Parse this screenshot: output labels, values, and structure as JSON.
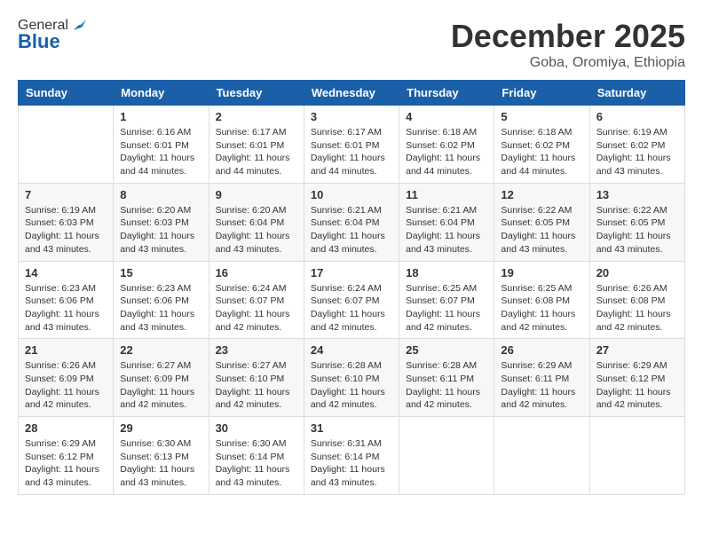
{
  "logo": {
    "general": "General",
    "blue": "Blue"
  },
  "header": {
    "month": "December 2025",
    "location": "Goba, Oromiya, Ethiopia"
  },
  "weekdays": [
    "Sunday",
    "Monday",
    "Tuesday",
    "Wednesday",
    "Thursday",
    "Friday",
    "Saturday"
  ],
  "weeks": [
    [
      {
        "day": "",
        "info": ""
      },
      {
        "day": "1",
        "info": "Sunrise: 6:16 AM\nSunset: 6:01 PM\nDaylight: 11 hours\nand 44 minutes."
      },
      {
        "day": "2",
        "info": "Sunrise: 6:17 AM\nSunset: 6:01 PM\nDaylight: 11 hours\nand 44 minutes."
      },
      {
        "day": "3",
        "info": "Sunrise: 6:17 AM\nSunset: 6:01 PM\nDaylight: 11 hours\nand 44 minutes."
      },
      {
        "day": "4",
        "info": "Sunrise: 6:18 AM\nSunset: 6:02 PM\nDaylight: 11 hours\nand 44 minutes."
      },
      {
        "day": "5",
        "info": "Sunrise: 6:18 AM\nSunset: 6:02 PM\nDaylight: 11 hours\nand 44 minutes."
      },
      {
        "day": "6",
        "info": "Sunrise: 6:19 AM\nSunset: 6:02 PM\nDaylight: 11 hours\nand 43 minutes."
      }
    ],
    [
      {
        "day": "7",
        "info": "Sunrise: 6:19 AM\nSunset: 6:03 PM\nDaylight: 11 hours\nand 43 minutes."
      },
      {
        "day": "8",
        "info": "Sunrise: 6:20 AM\nSunset: 6:03 PM\nDaylight: 11 hours\nand 43 minutes."
      },
      {
        "day": "9",
        "info": "Sunrise: 6:20 AM\nSunset: 6:04 PM\nDaylight: 11 hours\nand 43 minutes."
      },
      {
        "day": "10",
        "info": "Sunrise: 6:21 AM\nSunset: 6:04 PM\nDaylight: 11 hours\nand 43 minutes."
      },
      {
        "day": "11",
        "info": "Sunrise: 6:21 AM\nSunset: 6:04 PM\nDaylight: 11 hours\nand 43 minutes."
      },
      {
        "day": "12",
        "info": "Sunrise: 6:22 AM\nSunset: 6:05 PM\nDaylight: 11 hours\nand 43 minutes."
      },
      {
        "day": "13",
        "info": "Sunrise: 6:22 AM\nSunset: 6:05 PM\nDaylight: 11 hours\nand 43 minutes."
      }
    ],
    [
      {
        "day": "14",
        "info": "Sunrise: 6:23 AM\nSunset: 6:06 PM\nDaylight: 11 hours\nand 43 minutes."
      },
      {
        "day": "15",
        "info": "Sunrise: 6:23 AM\nSunset: 6:06 PM\nDaylight: 11 hours\nand 43 minutes."
      },
      {
        "day": "16",
        "info": "Sunrise: 6:24 AM\nSunset: 6:07 PM\nDaylight: 11 hours\nand 42 minutes."
      },
      {
        "day": "17",
        "info": "Sunrise: 6:24 AM\nSunset: 6:07 PM\nDaylight: 11 hours\nand 42 minutes."
      },
      {
        "day": "18",
        "info": "Sunrise: 6:25 AM\nSunset: 6:07 PM\nDaylight: 11 hours\nand 42 minutes."
      },
      {
        "day": "19",
        "info": "Sunrise: 6:25 AM\nSunset: 6:08 PM\nDaylight: 11 hours\nand 42 minutes."
      },
      {
        "day": "20",
        "info": "Sunrise: 6:26 AM\nSunset: 6:08 PM\nDaylight: 11 hours\nand 42 minutes."
      }
    ],
    [
      {
        "day": "21",
        "info": "Sunrise: 6:26 AM\nSunset: 6:09 PM\nDaylight: 11 hours\nand 42 minutes."
      },
      {
        "day": "22",
        "info": "Sunrise: 6:27 AM\nSunset: 6:09 PM\nDaylight: 11 hours\nand 42 minutes."
      },
      {
        "day": "23",
        "info": "Sunrise: 6:27 AM\nSunset: 6:10 PM\nDaylight: 11 hours\nand 42 minutes."
      },
      {
        "day": "24",
        "info": "Sunrise: 6:28 AM\nSunset: 6:10 PM\nDaylight: 11 hours\nand 42 minutes."
      },
      {
        "day": "25",
        "info": "Sunrise: 6:28 AM\nSunset: 6:11 PM\nDaylight: 11 hours\nand 42 minutes."
      },
      {
        "day": "26",
        "info": "Sunrise: 6:29 AM\nSunset: 6:11 PM\nDaylight: 11 hours\nand 42 minutes."
      },
      {
        "day": "27",
        "info": "Sunrise: 6:29 AM\nSunset: 6:12 PM\nDaylight: 11 hours\nand 42 minutes."
      }
    ],
    [
      {
        "day": "28",
        "info": "Sunrise: 6:29 AM\nSunset: 6:12 PM\nDaylight: 11 hours\nand 43 minutes."
      },
      {
        "day": "29",
        "info": "Sunrise: 6:30 AM\nSunset: 6:13 PM\nDaylight: 11 hours\nand 43 minutes."
      },
      {
        "day": "30",
        "info": "Sunrise: 6:30 AM\nSunset: 6:14 PM\nDaylight: 11 hours\nand 43 minutes."
      },
      {
        "day": "31",
        "info": "Sunrise: 6:31 AM\nSunset: 6:14 PM\nDaylight: 11 hours\nand 43 minutes."
      },
      {
        "day": "",
        "info": ""
      },
      {
        "day": "",
        "info": ""
      },
      {
        "day": "",
        "info": ""
      }
    ]
  ]
}
